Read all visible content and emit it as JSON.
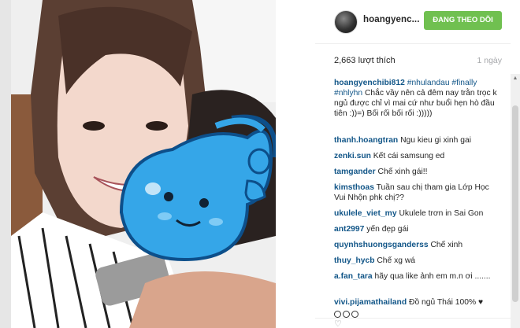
{
  "post": {
    "username": "hoangyenc...",
    "follow_label": "ĐANG THEO DÕI",
    "likes": "2,663 lượt thích",
    "time": "1 ngày"
  },
  "colors": {
    "follow_button": "#70c050",
    "username_link": "#125688",
    "meta_text": "#a5a7aa"
  },
  "caption": {
    "user": "hoangyenchibi812",
    "tags": "#nhulandau #finally #nhlyhn",
    "text": "Chắc vầy nên cả đêm nay trằn trọc k ngủ được chỉ vì mai cứ như buổi hẹn hò đầu tiên :))=) Bối rối bối rối :)))))"
  },
  "comments": [
    {
      "user": "thanh.hoangtran",
      "text": "Ngu kieu gi xinh gai"
    },
    {
      "user": "zenki.sun",
      "text": "Kết cái samsung ed"
    },
    {
      "user": "tamgander",
      "text": "Chế xinh gái!!"
    },
    {
      "user": "kimsthoas",
      "text": "Tuần sau chị tham gia Lớp Học Vui Nhộn phk chị??"
    },
    {
      "user": "ukulele_viet_my",
      "text": "Ukulele trơn in Sai Gon"
    },
    {
      "user": "ant2997",
      "text": "yến đẹp gái"
    },
    {
      "user": "quynhshuongsganderss",
      "text": "Chế xinh"
    },
    {
      "user": "thuy_hycb",
      "text": "Chế xg wá"
    },
    {
      "user": "a.fan_tara",
      "text": "hãy qua like ảnh em m.n ơi ......."
    },
    {
      "user": "vivi.pijamathailand",
      "text": "Đồ ngủ Thái 100%"
    }
  ],
  "icons": {
    "heart": "heart-icon",
    "scroll_up": "scroll-up-arrow-icon"
  }
}
